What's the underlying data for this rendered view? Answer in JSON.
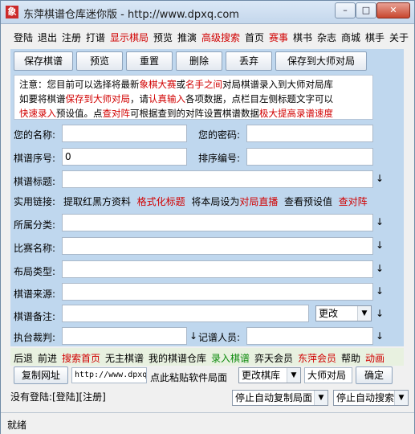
{
  "window": {
    "title": "东萍棋谱仓库迷你版 - http://www.dpxq.com",
    "minimize": "–",
    "maximize": "□",
    "close": "✕"
  },
  "menu": {
    "items": [
      "登陆",
      "退出",
      "注册",
      "打谱",
      "显示棋局",
      "预览",
      "推演",
      "高级搜索",
      "首页",
      "赛事",
      "棋书",
      "杂志",
      "商城",
      "棋手",
      "关于"
    ]
  },
  "toolbar": {
    "save": "保存棋谱",
    "preview": "预览",
    "reset": "重置",
    "delete": "删除",
    "discard": "丢弃",
    "save_master": "保存到大师对局"
  },
  "notice": {
    "p1": "注意：您目前可以选择将最新",
    "r1": "象棋大赛",
    "p2": "或",
    "r2": "名手之间",
    "p3": "对局棋谱录入到大师对局库",
    "p4": "如要将棋谱",
    "r3": "保存到大师对局",
    "p5": "，请",
    "r4": "认真输入",
    "p6": "各项数据，点栏目左侧标题文字可以",
    "r5": "快速录入",
    "p7": "预设值。点",
    "r6": "查对阵",
    "p8": "可根据查到的对阵设置棋谱数据",
    "r7": "极大提高录谱速度"
  },
  "form": {
    "name_label": "您的名称:",
    "password_label": "您的密码:",
    "serial_label": "棋谱序号:",
    "serial_value": "0",
    "sort_label": "排序编号:",
    "title_label": "棋谱标题:",
    "links_label": "实用链接:",
    "links": {
      "l1": "提取红黑方资料",
      "l2": "格式化标题",
      "l3a": "将本局设为",
      "l3b": "对局直播",
      "l4": "查看预设值",
      "l5": "查对阵"
    },
    "category_label": "所属分类:",
    "match_label": "比赛名称:",
    "layout_label": "布局类型:",
    "source_label": "棋谱来源:",
    "remark_label": "棋谱备注:",
    "change_select": "更改",
    "referee_label": "执台裁判:",
    "recorder_label": "记谱人员:"
  },
  "bottom_nav": {
    "items": [
      {
        "t": "后退",
        "c": "black"
      },
      {
        "t": "前进",
        "c": "black"
      },
      {
        "t": "搜索首页",
        "c": "red"
      },
      {
        "t": "无主棋谱",
        "c": "black"
      },
      {
        "t": "我的棋谱仓库",
        "c": "black"
      },
      {
        "t": "录入棋谱",
        "c": "red"
      },
      {
        "t": "弈天会员",
        "c": "black"
      },
      {
        "t": "东萍会员",
        "c": "red"
      },
      {
        "t": "帮助",
        "c": "black"
      },
      {
        "t": "动画",
        "c": "red"
      }
    ]
  },
  "copy_row": {
    "copy_button": "复制网址",
    "url_value": "http://www.dpxq",
    "paste_hint": "点此粘贴软件局面",
    "library_select": "更改棋库",
    "master_value": "大师对局",
    "confirm": "确定"
  },
  "status_line": {
    "text": "没有登陆:[登陆][注册]",
    "select1": "停止自动复制局面",
    "select2": "停止自动搜索"
  },
  "statusbar": {
    "text": "就绪"
  }
}
